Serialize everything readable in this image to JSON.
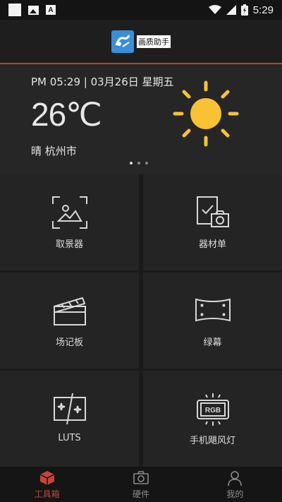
{
  "status_bar": {
    "time": "5:29"
  },
  "app": {
    "logo_text": "画质助手"
  },
  "weather": {
    "datetime": "PM 05:29 | 03月26日 星期五",
    "temperature": "26℃",
    "location": "晴 杭州市",
    "condition_icon": "sun-icon",
    "page_indicator": {
      "count": 3,
      "active": 0
    }
  },
  "tools": [
    {
      "label": "取景器",
      "icon": "viewfinder-icon"
    },
    {
      "label": "器材单",
      "icon": "equipment-list-icon"
    },
    {
      "label": "场记板",
      "icon": "clapperboard-icon"
    },
    {
      "label": "绿幕",
      "icon": "green-screen-icon"
    },
    {
      "label": "LUTS",
      "icon": "luts-icon"
    },
    {
      "label": "手机飓风灯",
      "icon": "rgb-light-icon"
    }
  ],
  "tabs": [
    {
      "label": "工具箱",
      "active": true
    },
    {
      "label": "硬件",
      "active": false
    },
    {
      "label": "我的",
      "active": false
    }
  ],
  "colors": {
    "accent": "#c5443a",
    "sun": "#f7c234",
    "logo_blue": "#3a8fd8"
  }
}
